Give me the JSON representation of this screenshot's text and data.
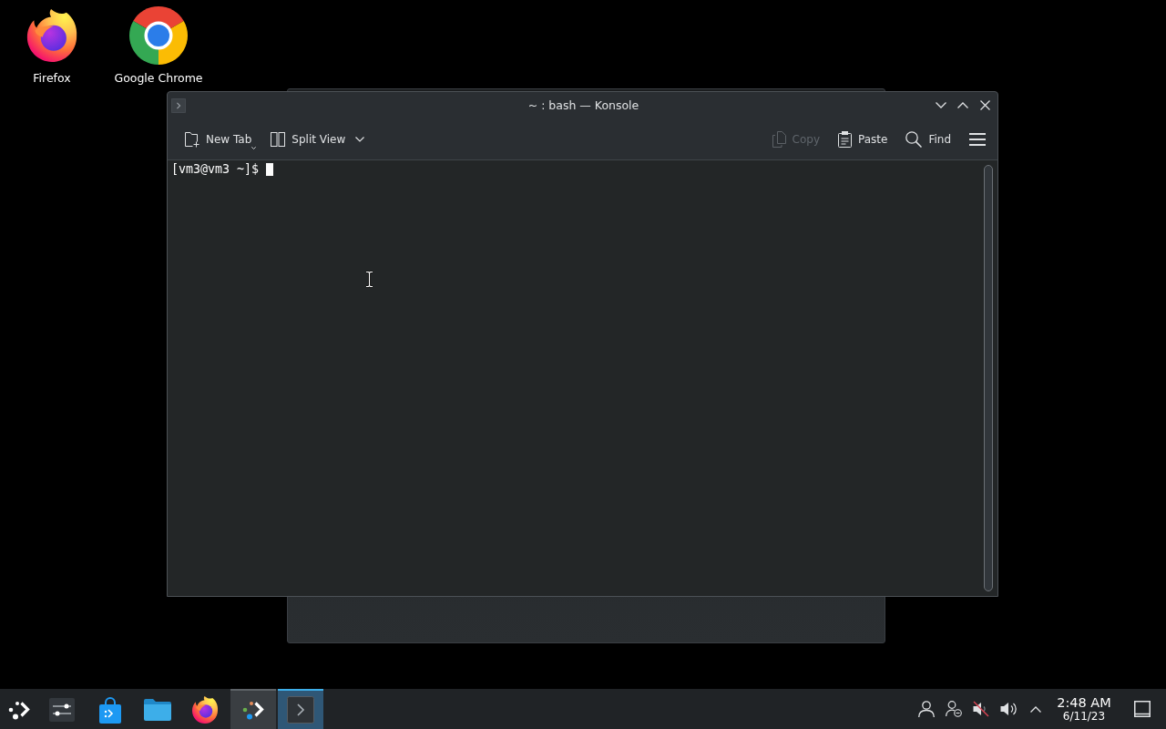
{
  "desktop": {
    "shortcuts": [
      {
        "kind": "firefox",
        "label": "Firefox",
        "selected": false
      },
      {
        "kind": "chrome",
        "label": "Google Chrome",
        "selected": false
      }
    ]
  },
  "window": {
    "title": "~ : bash — Konsole",
    "controls": [
      {
        "kind": "minimize"
      },
      {
        "kind": "maximize"
      },
      {
        "kind": "close"
      }
    ],
    "toolbar": {
      "left": [
        {
          "kind": "new-tab",
          "label": "New Tab",
          "menu_indicator": true,
          "dropdown": false,
          "disabled": false
        },
        {
          "kind": "split-view",
          "label": "Split View",
          "menu_indicator": false,
          "dropdown": true,
          "disabled": false
        }
      ],
      "right": [
        {
          "kind": "copy",
          "label": "Copy",
          "disabled": true
        },
        {
          "kind": "paste",
          "label": "Paste",
          "disabled": false
        },
        {
          "kind": "find",
          "label": "Find",
          "disabled": false
        },
        {
          "kind": "hamburger",
          "disabled": false
        }
      ]
    },
    "terminal": {
      "prompt": "[vm3@vm3 ~]$",
      "cursor": true
    }
  },
  "taskbar": {
    "items": [
      {
        "kind": "app-launcher",
        "open": false,
        "selected": false
      },
      {
        "kind": "system-settings",
        "open": false,
        "selected": false
      },
      {
        "kind": "software-store",
        "open": false,
        "selected": false
      },
      {
        "kind": "file-manager",
        "open": false,
        "selected": false
      },
      {
        "kind": "firefox",
        "open": false,
        "selected": false
      },
      {
        "kind": "dots-chevron",
        "open": true,
        "selected": false
      },
      {
        "kind": "terminal",
        "open": true,
        "selected": true
      }
    ],
    "tray": [
      {
        "kind": "user"
      },
      {
        "kind": "user-switch"
      },
      {
        "kind": "speaker",
        "muted": true
      },
      {
        "kind": "speaker",
        "muted": false
      },
      {
        "kind": "expand"
      }
    ],
    "clock": {
      "time": "2:48 AM",
      "date": "6/11/23"
    },
    "show_desktop": true
  }
}
